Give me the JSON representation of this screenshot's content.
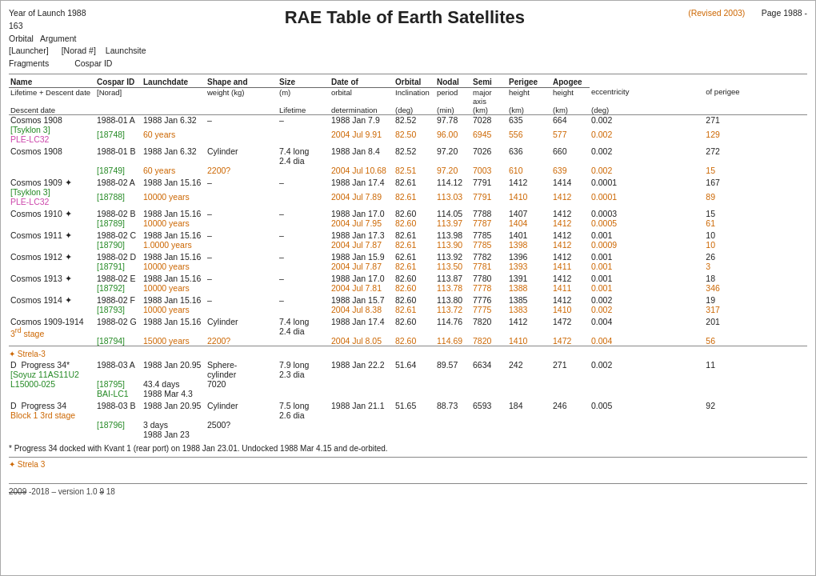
{
  "header": {
    "year_label": "Year of Launch 1988",
    "number": "163",
    "title": "RAE Table of Earth Satellites",
    "revised": "(Revised 2003)",
    "page_label": "Page 1988 -",
    "orbital_label": "Orbital",
    "launcher_label": "[Launcher]",
    "fragments_label": "Fragments",
    "argument_label": "Argument",
    "norad_label": "[Norad #]",
    "launchsite_label": "Launchsite",
    "cospar_label": "Cospar ID"
  },
  "col_headers": {
    "name": "Name",
    "cospar_id": "Cospar ID",
    "launchdate": "Launchdate",
    "shape": "Shape and",
    "size": "Size",
    "date_of": "Date of",
    "orbital": "Orbital",
    "nodal": "Nodal",
    "semi": "Semi",
    "perigee": "Perigee",
    "apogee": "Apogee",
    "lifetime": "Lifetime + Descent date",
    "norad": "[Norad]",
    "weight": "weight (kg)",
    "m": "(m)",
    "orbital_det": "orbital",
    "inclination": "Inclination",
    "period": "period",
    "major_axis": "major axis",
    "height": "height",
    "height2": "height",
    "eccentricity": "eccentricity",
    "of_perigee": "of perigee",
    "deg": "(deg)",
    "min": "(min)",
    "km": "(km)",
    "km2": "(km)",
    "km3": "(km)",
    "deg2": "(deg)",
    "descent": "Descent date",
    "lifetime_m": "Lifetime",
    "determination": "determination"
  },
  "entries": [
    {
      "id": "e1",
      "name": "Cosmos 1908",
      "sub": "[Tsyklon 3]",
      "sub2": "PLE-LC32",
      "cospar": "1988-01 A",
      "norad": "[18748]",
      "launch_date": "1988 Jan 6.32",
      "lifetime": "60 years",
      "shape": "–",
      "weight": "–",
      "det1_date": "1988 Jan 7.9",
      "det1_inc": "82.52",
      "det1_period": "97.78",
      "det1_axis": "7028",
      "det1_nodal": "635",
      "det1_semi": "664",
      "det1_ecc": "0.002",
      "det1_perigee": "271",
      "det2_date": "2004 Jul 9.91",
      "det2_inc": "82.50",
      "det2_period": "96.00",
      "det2_axis": "6945",
      "det2_nodal": "556",
      "det2_semi": "577",
      "det2_ecc": "0.002",
      "det2_perigee": "129",
      "has_orange": true
    },
    {
      "id": "e2",
      "name": "Cosmos 1908",
      "sub": null,
      "sub2": null,
      "cospar": "1988-01 B",
      "norad": "[18749]",
      "launch_date": "1988 Jan 6.32",
      "lifetime": "60 years",
      "shape": "Cylinder",
      "weight": "7.4 long",
      "weight2": "2200?",
      "weight3": "2.4 dia",
      "det1_date": "1988 Jan 8.4",
      "det1_inc": "82.52",
      "det1_period": "97.20",
      "det1_axis": "7026",
      "det1_nodal": "636",
      "det1_semi": "660",
      "det1_ecc": "0.002",
      "det1_perigee": "272",
      "det2_date": "2004 Jul 10.68",
      "det2_inc": "82.51",
      "det2_period": "97.20",
      "det2_axis": "7003",
      "det2_nodal": "610",
      "det2_semi": "639",
      "det2_ecc": "0.002",
      "det2_perigee": "15",
      "has_orange": true
    },
    {
      "id": "e3",
      "name": "Cosmos 1909 ✦",
      "sub": "[Tsyklon 3]",
      "sub2": "PLE-LC32",
      "cospar": "1988-02 A",
      "norad": "[18788]",
      "launch_date": "1988 Jan 15.16",
      "lifetime": "10000 years",
      "shape": "–",
      "weight": "–",
      "det1_date": "1988 Jan 17.4",
      "det1_inc": "82.61",
      "det1_period": "114.12",
      "det1_axis": "7791",
      "det1_nodal": "1412",
      "det1_semi": "1414",
      "det1_ecc": "0.0001",
      "det1_perigee": "167",
      "det2_date": "2004 Jul 7.89",
      "det2_inc": "82.61",
      "det2_period": "113.03",
      "det2_axis": "7791",
      "det2_nodal": "1410",
      "det2_semi": "1412",
      "det2_ecc": "0.0001",
      "det2_perigee": "89",
      "has_orange": true
    },
    {
      "id": "e4",
      "name": "Cosmos 1910 ✦",
      "sub": null,
      "sub2": null,
      "cospar": "1988-02 B",
      "norad": "[18789]",
      "launch_date": "1988 Jan 15.16",
      "lifetime": "10000 years",
      "shape": "–",
      "weight": "–",
      "det1_date": "1988 Jan 17.0",
      "det1_inc": "82.60",
      "det1_period": "114.05",
      "det1_axis": "7788",
      "det1_nodal": "1407",
      "det1_semi": "1412",
      "det1_ecc": "0.0003",
      "det1_perigee": "15",
      "det2_date": "2004 Jul 7.95",
      "det2_inc": "82.60",
      "det2_period": "113.97",
      "det2_axis": "7787",
      "det2_nodal": "1404",
      "det2_semi": "1412",
      "det2_ecc": "0.0005",
      "det2_perigee": "61",
      "has_orange": true
    },
    {
      "id": "e5",
      "name": "Cosmos 1911 ✦",
      "sub": null,
      "sub2": null,
      "cospar": "1988-02 C",
      "norad": "[18790]",
      "launch_date": "1988 Jan 15.16",
      "lifetime": "1.0000 years",
      "shape": "–",
      "weight": "–",
      "det1_date": "1988 Jan 17.3",
      "det1_inc": "82.61",
      "det1_period": "113.98",
      "det1_axis": "7785",
      "det1_nodal": "1401",
      "det1_semi": "1412",
      "det1_ecc": "0.001",
      "det1_perigee": "10",
      "det2_date": "2004 Jul 7.87",
      "det2_inc": "82.61",
      "det2_period": "113.90",
      "det2_axis": "7785",
      "det2_nodal": "1398",
      "det2_semi": "1412",
      "det2_ecc": "0.0009",
      "det2_perigee": "10",
      "has_orange": true
    },
    {
      "id": "e6",
      "name": "Cosmos 1912 ✦",
      "sub": null,
      "sub2": null,
      "cospar": "1988-02 D",
      "norad": "[18791]",
      "launch_date": "1988 Jan 15.16",
      "lifetime": "10000 years",
      "shape": "–",
      "weight": "–",
      "det1_date": "1988 Jan 15.9",
      "det1_inc": "62.61",
      "det1_period": "113.92",
      "det1_axis": "7782",
      "det1_nodal": "1396",
      "det1_semi": "1412",
      "det1_ecc": "0.001",
      "det1_perigee": "26",
      "det2_date": "2004 Jul 7.87",
      "det2_inc": "82.61",
      "det2_period": "113.50",
      "det2_axis": "7781",
      "det2_nodal": "1393",
      "det2_semi": "1411",
      "det2_ecc": "0.001",
      "det2_perigee": "3",
      "has_orange": true
    },
    {
      "id": "e7",
      "name": "Cosmos 1913 ✦",
      "sub": null,
      "sub2": null,
      "cospar": "1988-02 E",
      "norad": "[18792]",
      "launch_date": "1988 Jan 15.16",
      "lifetime": "10000 years",
      "shape": "–",
      "weight": "–",
      "det1_date": "1988 Jan 17.0",
      "det1_inc": "82.60",
      "det1_period": "113.87",
      "det1_axis": "7780",
      "det1_nodal": "1391",
      "det1_semi": "1412",
      "det1_ecc": "0.001",
      "det1_perigee": "18",
      "det2_date": "2004 Jul 7.81",
      "det2_inc": "82.60",
      "det2_period": "113.78",
      "det2_axis": "7778",
      "det2_nodal": "1388",
      "det2_semi": "1411",
      "det2_ecc": "0.001",
      "det2_perigee": "346",
      "has_orange": true
    },
    {
      "id": "e8",
      "name": "Cosmos 1914 ✦",
      "sub": null,
      "sub2": null,
      "cospar": "1988-02 F",
      "norad": "[18793]",
      "launch_date": "1988 Jan 15.16",
      "lifetime": "10000 years",
      "shape": "–",
      "weight": "–",
      "det1_date": "1988 Jan 15.7",
      "det1_inc": "82.60",
      "det1_period": "113.80",
      "det1_axis": "7776",
      "det1_nodal": "1385",
      "det1_semi": "1412",
      "det1_ecc": "0.002",
      "det1_perigee": "19",
      "det2_date": "2004 Jul 8.38",
      "det2_inc": "82.61",
      "det2_period": "113.72",
      "det2_axis": "7775",
      "det2_nodal": "1383",
      "det2_semi": "1410",
      "det2_ecc": "0.002",
      "det2_perigee": "317",
      "has_orange": true
    },
    {
      "id": "e9",
      "name": "Cosmos 1909-1914",
      "sub": "3rd stage",
      "sub2": null,
      "cospar": "1988-02 G",
      "norad": "[18794]",
      "launch_date": "1988 Jan 15.16",
      "lifetime": "15000 years",
      "shape": "Cylinder",
      "weight": "7.4 long",
      "weight2": "2200?",
      "weight3": "2.4 dia",
      "det1_date": "1988 Jan 17.4",
      "det1_inc": "82.60",
      "det1_period": "114.76",
      "det1_axis": "7820",
      "det1_nodal": "1412",
      "det1_semi": "1472",
      "det1_ecc": "0.004",
      "det1_perigee": "201",
      "det2_date": "2004 Jul 8.05",
      "det2_inc": "82.60",
      "det2_period": "114.69",
      "det2_axis": "7820",
      "det2_nodal": "1410",
      "det2_semi": "1472",
      "det2_ecc": "0.004",
      "det2_perigee": "56",
      "has_orange": true,
      "is_stage": true
    }
  ],
  "progress_entries": [
    {
      "id": "p1",
      "prefix": "D",
      "name": "Progress 34*",
      "sub": "[Soyuz 11AS11U2",
      "sub2": "L15000-025",
      "cospar": "1988-03 A",
      "norad": "[18795]",
      "norad2": "BAI-LC1",
      "launch_date": "1988 Jan 20.95",
      "lifetime": "43.4 days",
      "lifetime2": "1988 Mar 4.3",
      "shape": "Sphere-\ncylinder",
      "weight": "7.9 long",
      "weight2": "7020",
      "weight3": "2.3 dia",
      "det1_date": "1988 Jan 22.2",
      "det1_inc": "51.64",
      "det1_period": "89.57",
      "det1_axis": "6634",
      "det1_nodal": "242",
      "det1_semi": "271",
      "det1_ecc": "0.002",
      "det1_perigee": "11"
    },
    {
      "id": "p2",
      "prefix": "D",
      "name": "Progress 34",
      "sub": "Block 1 3rd stage",
      "sub2": null,
      "cospar": "1988-03 B",
      "norad": "[18796]",
      "launch_date": "1988 Jan 20.95",
      "lifetime": "3 days",
      "lifetime2": "1988 Jan 23",
      "shape": "Cylinder",
      "weight": "7.5 long",
      "weight2": "2500?",
      "weight3": "2.6 dia",
      "det1_date": "1988 Jan 21.1",
      "det1_inc": "51.65",
      "det1_period": "88.73",
      "det1_axis": "6593",
      "det1_nodal": "184",
      "det1_semi": "246",
      "det1_ecc": "0.005",
      "det1_perigee": "92"
    }
  ],
  "footnote": "* Progress 34 docked with Kvant 1 (rear port) on 1988 Jan 23.01. Undocked 1988 Mar 4.15 and de-orbited.",
  "footer": {
    "version": "2009-2018 – version 1.0918"
  },
  "strela_label": "✦  Strela-3",
  "strela_label2": "✦  Strela 3"
}
